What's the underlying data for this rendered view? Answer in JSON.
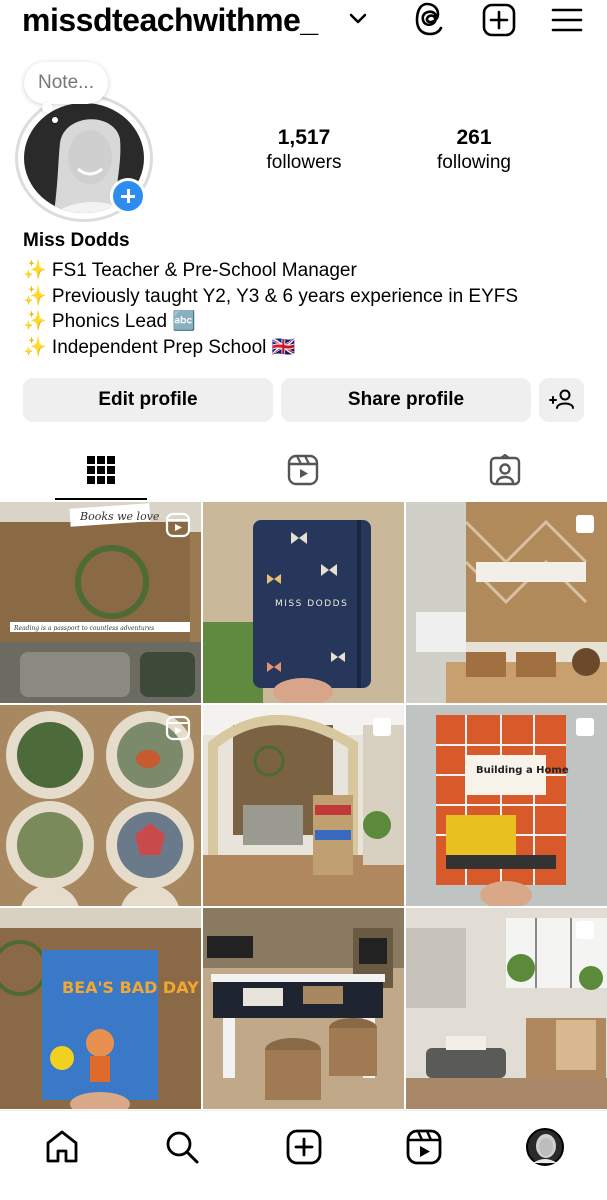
{
  "header": {
    "username": "missdteachwithme_",
    "icons": [
      "chevron-down-icon",
      "threads-icon",
      "create-plus-icon",
      "menu-icon"
    ]
  },
  "profile": {
    "note_placeholder": "Note...",
    "followers_count": "1,517",
    "followers_label": "followers",
    "following_count": "261",
    "following_label": "following",
    "display_name": "Miss Dodds",
    "bio_lines": [
      "✨ FS1 Teacher & Pre-School Manager",
      "✨ Previously taught Y2, Y3 & 6 years experience in EYFS",
      "✨ Phonics Lead 🔤",
      "✨ Independent Prep School 🇬🇧"
    ]
  },
  "actions": {
    "edit_profile": "Edit profile",
    "share_profile": "Share profile"
  },
  "tabs": [
    {
      "name": "posts-grid",
      "icon": "grid-icon",
      "active": true
    },
    {
      "name": "reels",
      "icon": "reels-icon",
      "active": false
    },
    {
      "name": "tagged",
      "icon": "tagged-person-icon",
      "active": false
    }
  ],
  "posts": [
    {
      "caption_text": "Books we love",
      "subcaption": "Reading is a passport to countless adventures",
      "overlay": "reel"
    },
    {
      "caption_text": "MISS DODDS",
      "overlay": "none"
    },
    {
      "caption_text": "",
      "overlay": "multiple"
    },
    {
      "caption_text": "",
      "overlay": "reel"
    },
    {
      "caption_text": "",
      "overlay": "multiple"
    },
    {
      "caption_text": "Building a Home",
      "overlay": "multiple"
    },
    {
      "caption_text": "BEA'S BAD DAY",
      "overlay": "none"
    },
    {
      "caption_text": "",
      "overlay": "none"
    },
    {
      "caption_text": "",
      "overlay": "multiple"
    }
  ],
  "bottom_nav": [
    "home-icon",
    "search-icon",
    "create-icon",
    "reels-icon",
    "profile-avatar"
  ],
  "colors": {
    "accent_blue": "#2d8cf0",
    "button_bg": "#efefef"
  }
}
